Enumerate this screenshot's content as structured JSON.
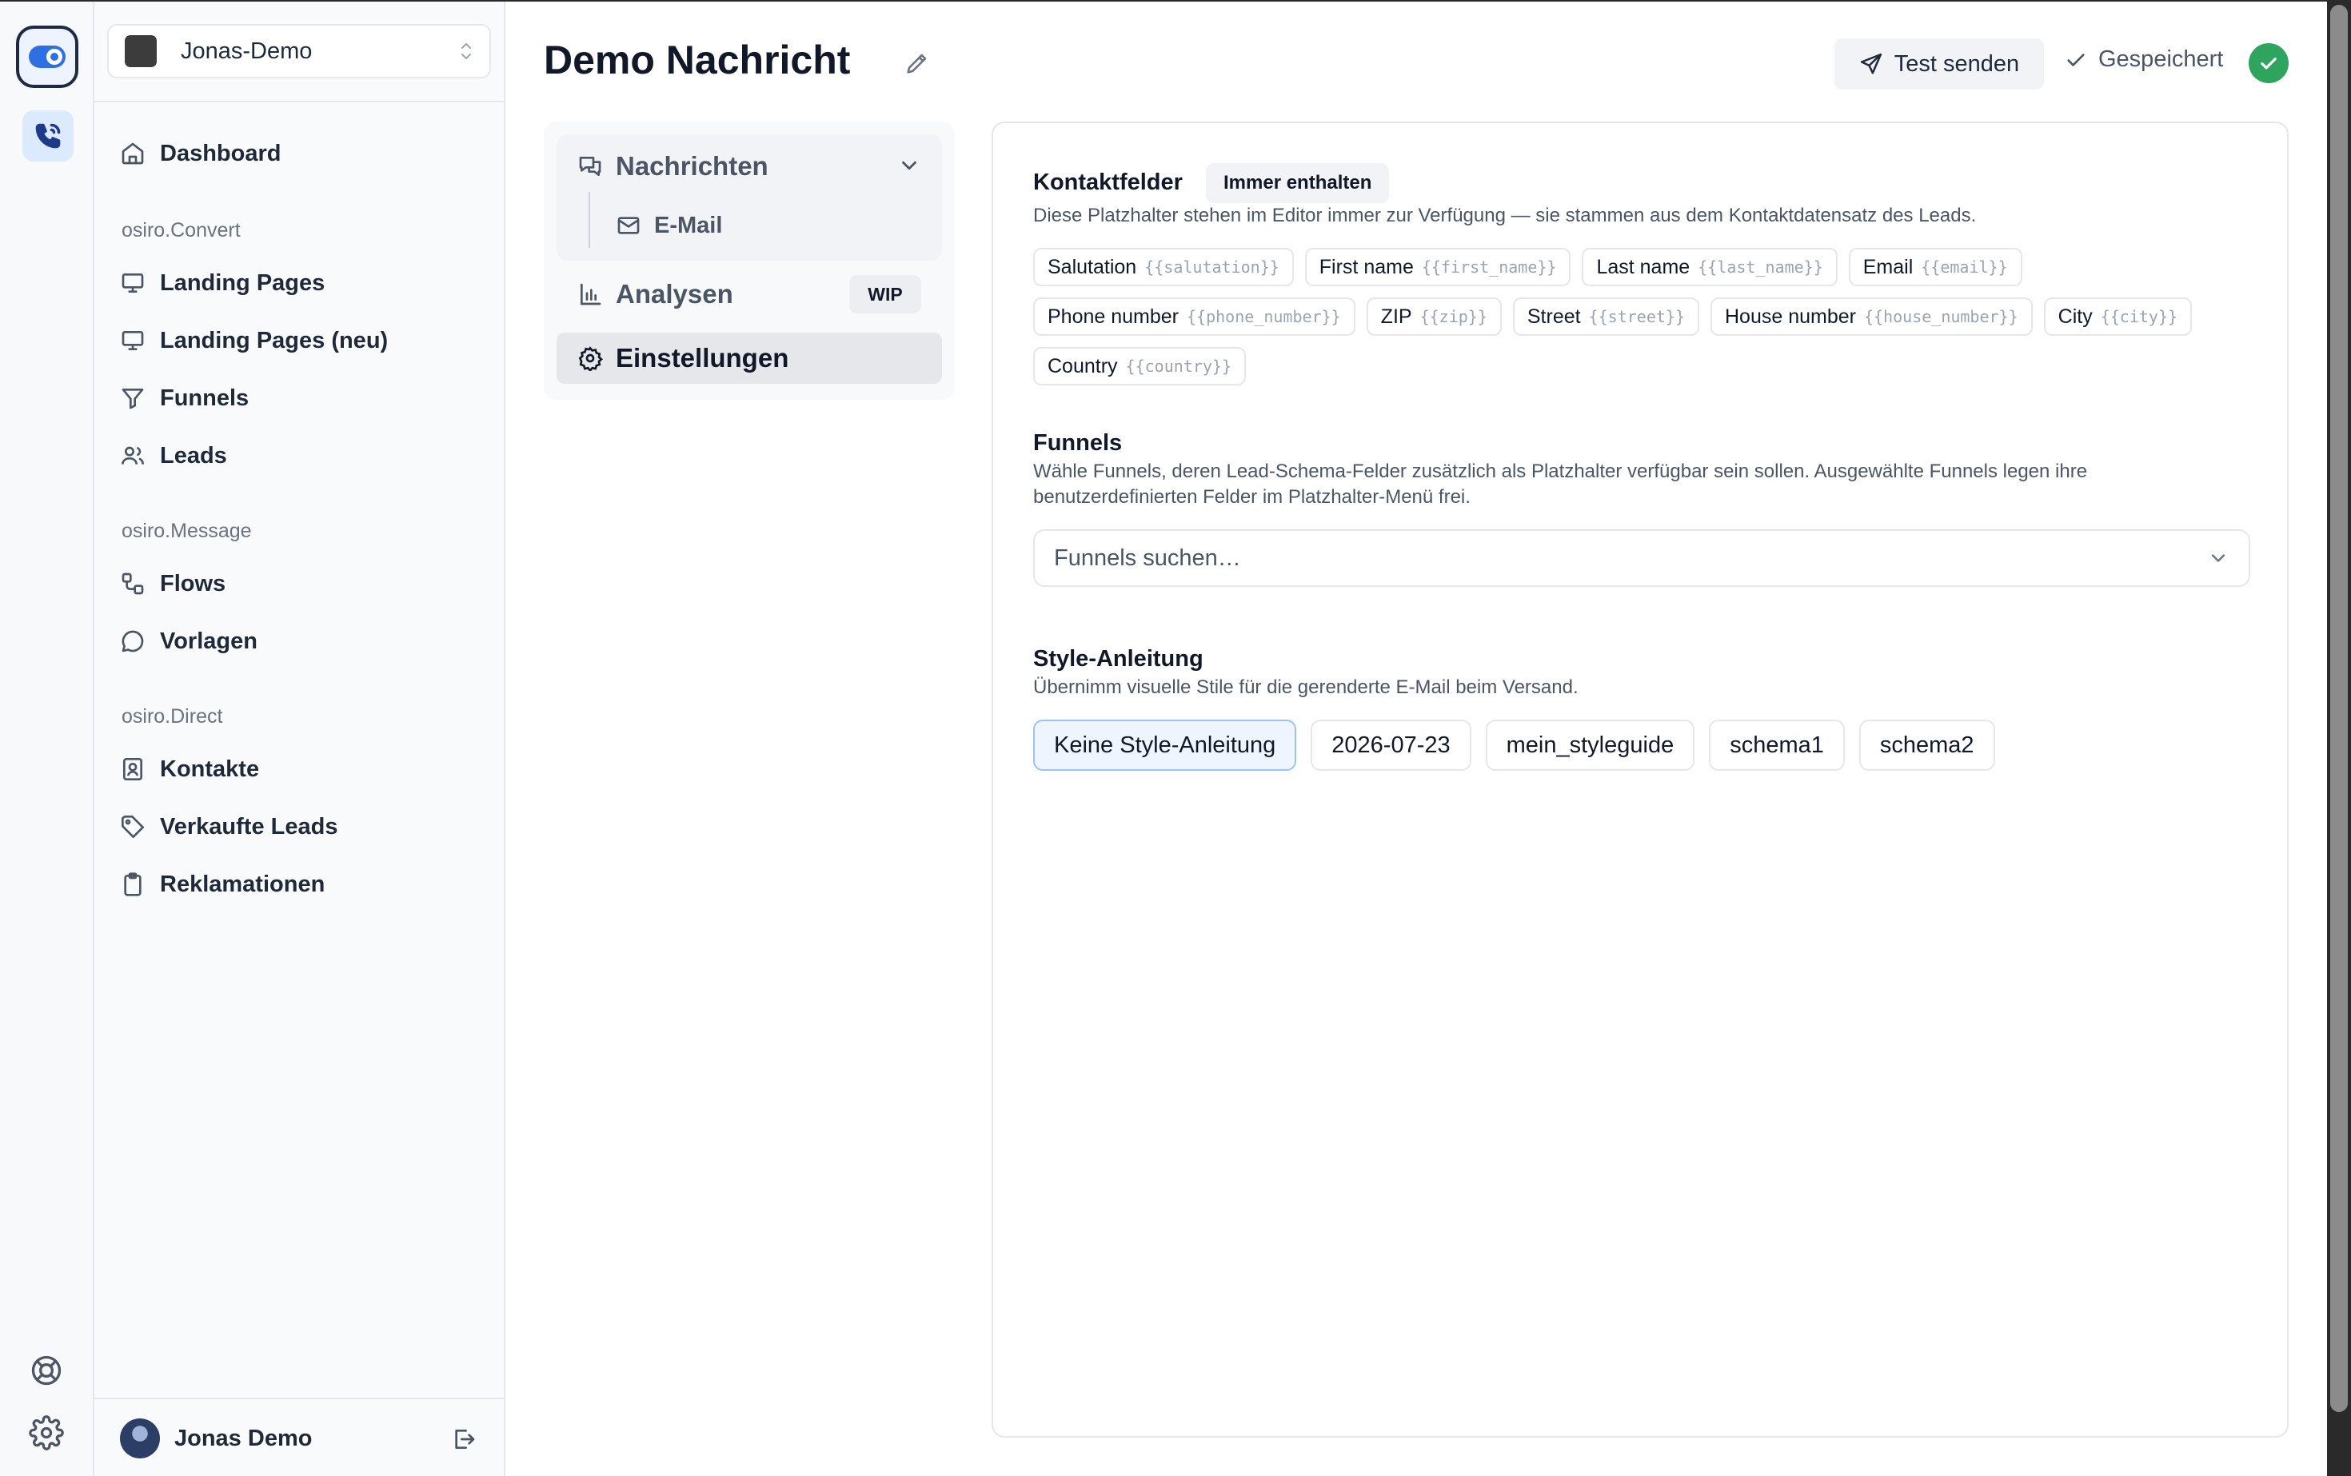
{
  "workspace": {
    "name": "Jonas-Demo"
  },
  "sidebar": {
    "dashboard": "Dashboard",
    "sections": [
      {
        "title": "osiro.Convert",
        "items": [
          "Landing Pages",
          "Landing Pages (neu)",
          "Funnels",
          "Leads"
        ]
      },
      {
        "title": "osiro.Message",
        "items": [
          "Flows",
          "Vorlagen"
        ]
      },
      {
        "title": "osiro.Direct",
        "items": [
          "Kontakte",
          "Verkaufte Leads",
          "Reklamationen"
        ]
      }
    ],
    "user": {
      "name": "Jonas Demo"
    }
  },
  "header": {
    "title": "Demo Nachricht",
    "test_button": "Test senden",
    "status": "Gespeichert"
  },
  "inner_nav": {
    "messages": "Nachrichten",
    "email": "E-Mail",
    "analyses": "Analysen",
    "analyses_badge": "WIP",
    "settings": "Einstellungen"
  },
  "contact_fields": {
    "title": "Kontaktfelder",
    "badge": "Immer enthalten",
    "description": "Diese Platzhalter stehen im Editor immer zur Verfügung — sie stammen aus dem Kontaktdatensatz des Leads.",
    "chips": [
      {
        "label": "Salutation",
        "placeholder": "{{salutation}}"
      },
      {
        "label": "First name",
        "placeholder": "{{first_name}}"
      },
      {
        "label": "Last name",
        "placeholder": "{{last_name}}"
      },
      {
        "label": "Email",
        "placeholder": "{{email}}"
      },
      {
        "label": "Phone number",
        "placeholder": "{{phone_number}}"
      },
      {
        "label": "ZIP",
        "placeholder": "{{zip}}"
      },
      {
        "label": "Street",
        "placeholder": "{{street}}"
      },
      {
        "label": "House number",
        "placeholder": "{{house_number}}"
      },
      {
        "label": "City",
        "placeholder": "{{city}}"
      },
      {
        "label": "Country",
        "placeholder": "{{country}}"
      }
    ]
  },
  "funnels": {
    "title": "Funnels",
    "description": "Wähle Funnels, deren Lead-Schema-Felder zusätzlich als Platzhalter verfügbar sein sollen. Ausgewählte Funnels legen ihre benutzerdefinierten Felder im Platzhalter-Menü frei.",
    "placeholder": "Funnels suchen…"
  },
  "style_guide": {
    "title": "Style-Anleitung",
    "description": "Übernimm visuelle Stile für die gerenderte E-Mail beim Versand.",
    "options": [
      "Keine Style-Anleitung",
      "2026-07-23",
      "mein_styleguide",
      "schema1",
      "schema2"
    ],
    "selected": "Keine Style-Anleitung"
  },
  "colors": {
    "accent": "#2563eb",
    "success": "#2fa45e",
    "selected_bg": "#eef5ff"
  }
}
